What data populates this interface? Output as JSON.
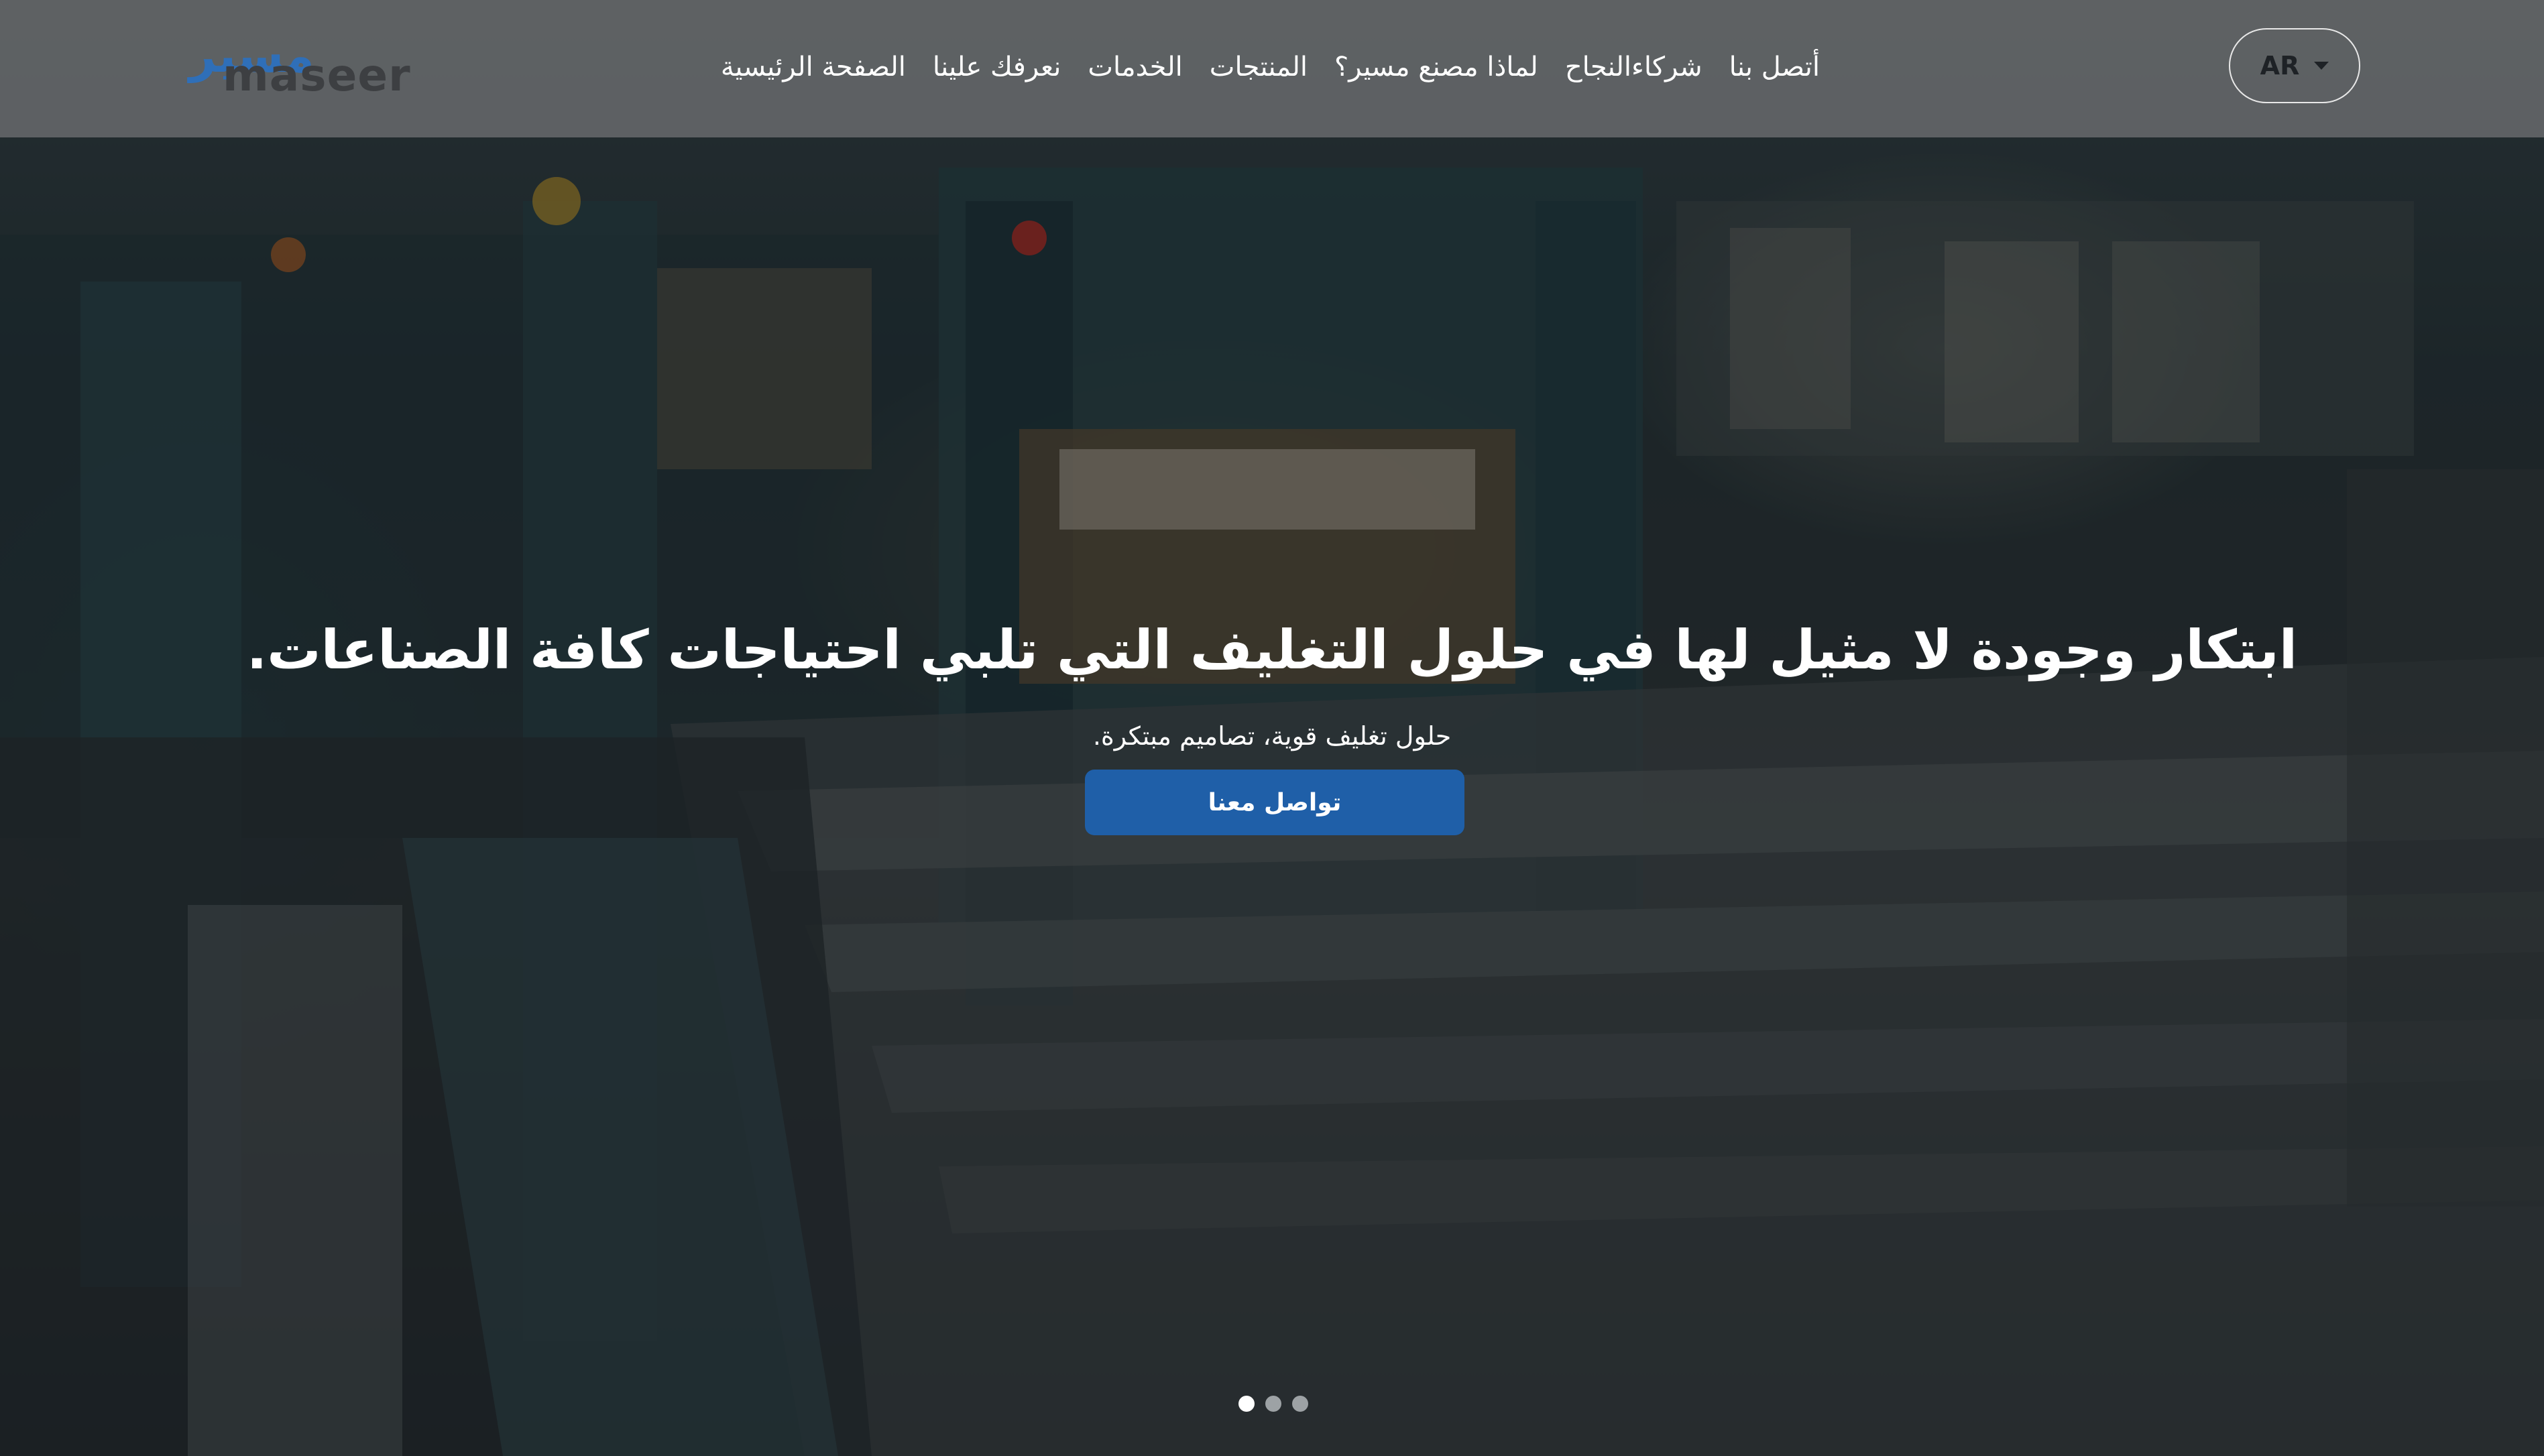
{
  "brand": {
    "logo_ar": "مسير",
    "logo_en": "maseer",
    "accent_color": "#1f5fa8"
  },
  "nav": {
    "items": [
      {
        "label": "الصفحة الرئيسية"
      },
      {
        "label": "نعرفك علينا"
      },
      {
        "label": "الخدمات"
      },
      {
        "label": "المنتجات"
      },
      {
        "label": "لماذا مصنع مسير؟"
      },
      {
        "label": "شركاءالنجاح"
      },
      {
        "label": "أتصل بنا"
      }
    ],
    "language": {
      "selected": "AR",
      "icon": "chevron-down-icon"
    }
  },
  "hero": {
    "title": "ابتكار وجودة لا مثيل لها في حلول التغليف التي تلبي احتياجات كافة الصناعات.",
    "subtitle": "حلول تغليف قوية، تصاميم مبتكرة.",
    "cta_label": "تواصل معنا",
    "carousel": {
      "slide_count": 3,
      "active_index": 0
    }
  }
}
